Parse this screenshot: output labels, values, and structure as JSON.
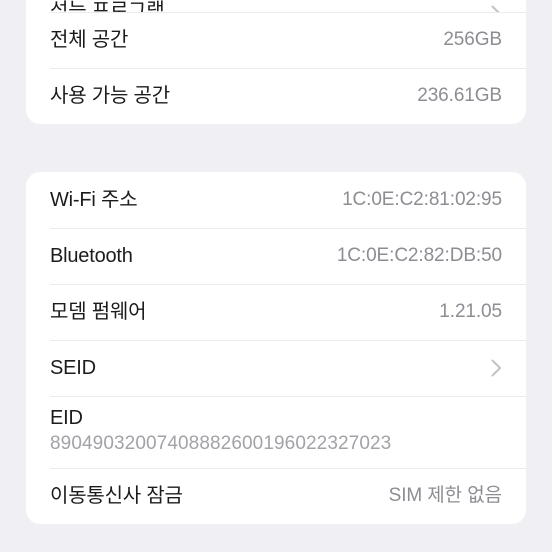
{
  "screen": {
    "background_color": "#f0eff4",
    "card_color": "#ffffff",
    "label_color": "#1c1c1e",
    "value_color": "#8d8d93",
    "separator_color": "#ececef",
    "chevron_color": "#c2c2c7"
  },
  "storage_section": {
    "rows": [
      {
        "label": "성능 프로그램",
        "value": "",
        "accessory": "chevron-right-icon",
        "clipped": true
      },
      {
        "label": "전체 공간",
        "value": "256GB",
        "accessory": "none",
        "clipped": false
      },
      {
        "label": "사용 가능 공간",
        "value": "236.61GB",
        "accessory": "none",
        "clipped": false
      }
    ]
  },
  "network_section": {
    "rows": [
      {
        "label": "Wi-Fi 주소",
        "value": "1C:0E:C2:81:02:95",
        "accessory": "none"
      },
      {
        "label": "Bluetooth",
        "value": "1C:0E:C2:82:DB:50",
        "accessory": "none"
      },
      {
        "label": "모뎀 펌웨어",
        "value": "1.21.05",
        "accessory": "none"
      },
      {
        "label": "SEID",
        "value": "",
        "accessory": "chevron-right-icon"
      },
      {
        "label": "EID",
        "subvalue": "89049032007408882600196022327023",
        "accessory": "none",
        "stacked": true
      },
      {
        "label": "이동통신사 잠금",
        "value": "SIM 제한 없음",
        "accessory": "none"
      }
    ]
  }
}
